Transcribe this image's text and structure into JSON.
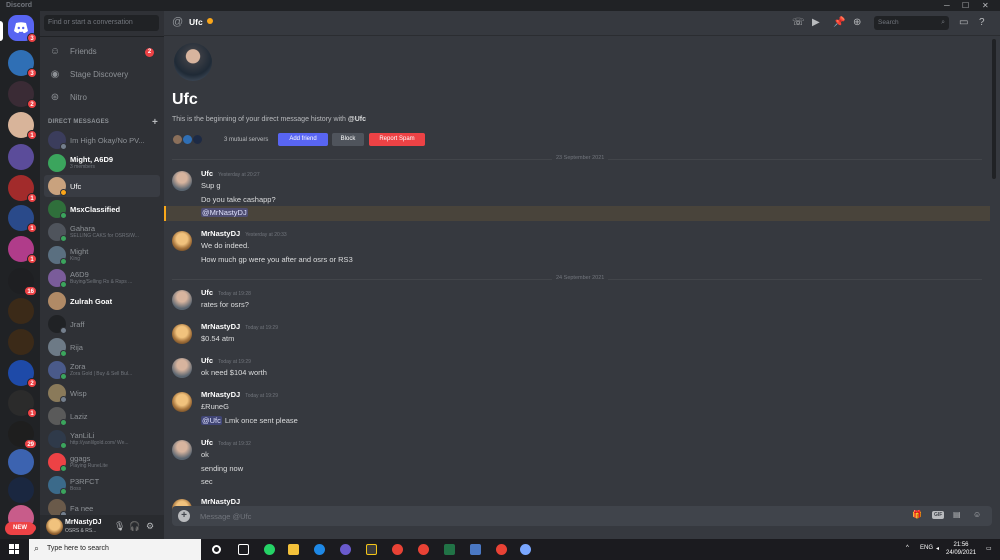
{
  "window": {
    "title": "Discord"
  },
  "rail": {
    "home_badge": "3",
    "servers": [
      {
        "icon": "server-blue-icon",
        "badge": "3"
      },
      {
        "icon": "server-dark-icon",
        "badge": "2"
      },
      {
        "icon": "server-avatar-icon",
        "badge": "1"
      },
      {
        "icon": "server-purple-icon",
        "badge": ""
      },
      {
        "icon": "server-red-icon",
        "badge": "1"
      },
      {
        "icon": "server-guild-icon",
        "badge": "1"
      },
      {
        "icon": "server-pink-icon",
        "badge": "1"
      },
      {
        "icon": "server-mask-icon",
        "badge": "16"
      },
      {
        "icon": "server-runestash-icon",
        "badge": ""
      },
      {
        "icon": "server-runestash2-icon",
        "badge": ""
      },
      {
        "icon": "server-bluefire-icon",
        "badge": "2"
      },
      {
        "icon": "server-syme-icon",
        "badge": "1"
      },
      {
        "icon": "server-gold-icon",
        "badge": "29"
      },
      {
        "icon": "server-crest-icon",
        "badge": ""
      },
      {
        "icon": "server-central-icon",
        "badge": ""
      },
      {
        "icon": "server-colorful-icon",
        "badge": "1"
      }
    ],
    "new_label": "NEW"
  },
  "dms": {
    "search_placeholder": "Find or start a conversation",
    "nav": [
      {
        "label": "Friends",
        "icon": "friends-icon",
        "badge": "2"
      },
      {
        "label": "Stage Discovery",
        "icon": "stage-icon",
        "badge": ""
      },
      {
        "label": "Nitro",
        "icon": "nitro-icon",
        "badge": ""
      }
    ],
    "header": "DIRECT MESSAGES",
    "items": [
      {
        "name": "Im High Okay/No PV...",
        "sub": "",
        "bold": false
      },
      {
        "name": "Might, A6D9",
        "sub": "3 members",
        "bold": true
      },
      {
        "name": "Ufc",
        "sub": "",
        "bold": false
      },
      {
        "name": "MsxClassified",
        "sub": "",
        "bold": true
      },
      {
        "name": "Gahara",
        "sub": "SELLING CAKS for OSRS/W...",
        "bold": false
      },
      {
        "name": "Might",
        "sub": "King",
        "bold": false
      },
      {
        "name": "A6D9",
        "sub": "Buying/Selling Rs & Rsps ...",
        "bold": false
      },
      {
        "name": "Zulrah Goat",
        "sub": "",
        "bold": true
      },
      {
        "name": "Jraff",
        "sub": "",
        "bold": false
      },
      {
        "name": "Rija",
        "sub": "",
        "bold": false
      },
      {
        "name": "Zora",
        "sub": "Zora Gold | Buy & Sell Bul...",
        "bold": false
      },
      {
        "name": "Wisp",
        "sub": "",
        "bold": false
      },
      {
        "name": "Laziz",
        "sub": "",
        "bold": false
      },
      {
        "name": "YanLiLi",
        "sub": "http://yanlilgold.com/ We...",
        "bold": false
      },
      {
        "name": "ggags",
        "sub": "Playing RuneLite",
        "bold": false
      },
      {
        "name": "P3RFCT",
        "sub": "Boss",
        "bold": false
      },
      {
        "name": "Fa nee",
        "sub": "",
        "bold": false
      }
    ]
  },
  "user": {
    "name": "MrNastyDJ",
    "status": "OSRS & RS..."
  },
  "channel": {
    "name": "Ufc",
    "search_placeholder": "Search",
    "intro_name": "Ufc",
    "intro_text_prefix": "This is the beginning of your direct message history with",
    "intro_text_user": "@Ufc",
    "mutual": "3 mutual servers",
    "add_friend": "Add friend",
    "block": "Block",
    "report": "Report Spam",
    "composer_placeholder": "Message @Ufc"
  },
  "dates": [
    "23 September 2021",
    "24 September 2021"
  ],
  "messages": [
    {
      "author": "Ufc",
      "time": "Yesterday at 20:27",
      "lines": [
        "Sup g",
        "Do you take cashapp?",
        "@MrNastyDJ"
      ]
    },
    {
      "author": "MrNastyDJ",
      "time": "Yesterday at 20:33",
      "lines": [
        "We do indeed.",
        "How much gp were you after and osrs or RS3"
      ]
    },
    {
      "author": "Ufc",
      "time": "Today at 19:28",
      "lines": [
        "rates for osrs?"
      ]
    },
    {
      "author": "MrNastyDJ",
      "time": "Today at 19:29",
      "lines": [
        "$0.54 atm"
      ]
    },
    {
      "author": "Ufc",
      "time": "Today at 19:29",
      "lines": [
        "ok need $104 worth"
      ]
    },
    {
      "author": "MrNastyDJ",
      "time": "Today at 19:29",
      "lines": [
        "£RuneG",
        "@Ufc",
        "Lmk once sent please"
      ]
    },
    {
      "author": "Ufc",
      "time": "Today at 19:32",
      "lines": [
        "ok",
        "sending now",
        "sec"
      ]
    },
    {
      "author": "MrNastyDJ",
      "time": "",
      "lines": []
    }
  ],
  "taskbar": {
    "search_placeholder": "Type here to search",
    "lang": "ENG",
    "time": "21:56",
    "date": "24/09/2021"
  },
  "colors": {
    "blurple": "#5865f2",
    "red": "#ed4245",
    "mention_highlight": "#faa81a"
  }
}
